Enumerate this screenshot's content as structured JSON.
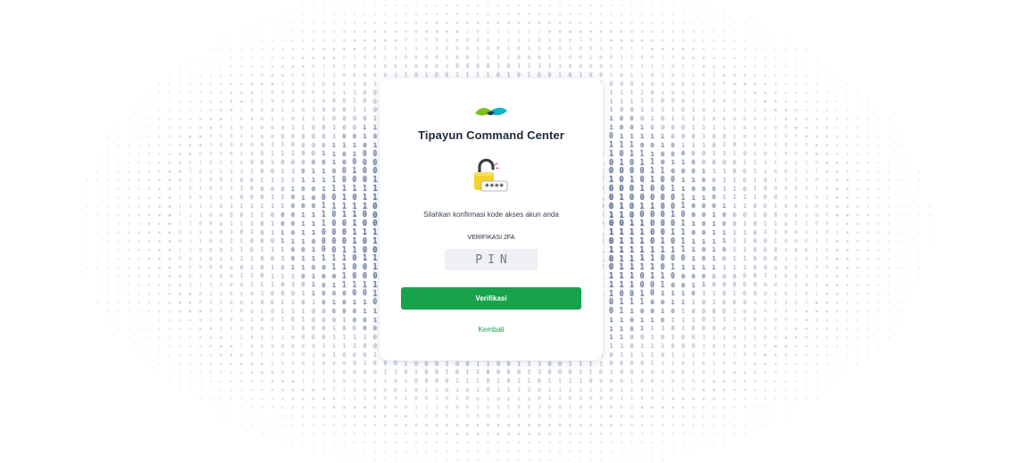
{
  "app": {
    "title": "Tipayun Command Center"
  },
  "auth": {
    "subtitle": "Silahkan konfirmasi kode akses akun anda",
    "pin_label": "VERIFIKASI 2FA",
    "pin_placeholder": "PIN",
    "pin_value": "",
    "lock_badge_text": "****",
    "verify_button_label": "Verifikasi",
    "back_link_label": "Kembali"
  },
  "icons": {
    "logo": "brand-logo-icon",
    "lock": "open-padlock-pin-icon"
  },
  "colors": {
    "accent_green": "#16a34a",
    "logo_green": "#7cc21f",
    "logo_teal": "#10b3c7",
    "lock_yellow": "#f5d32b",
    "binary_digits": "#1e3a6e"
  }
}
